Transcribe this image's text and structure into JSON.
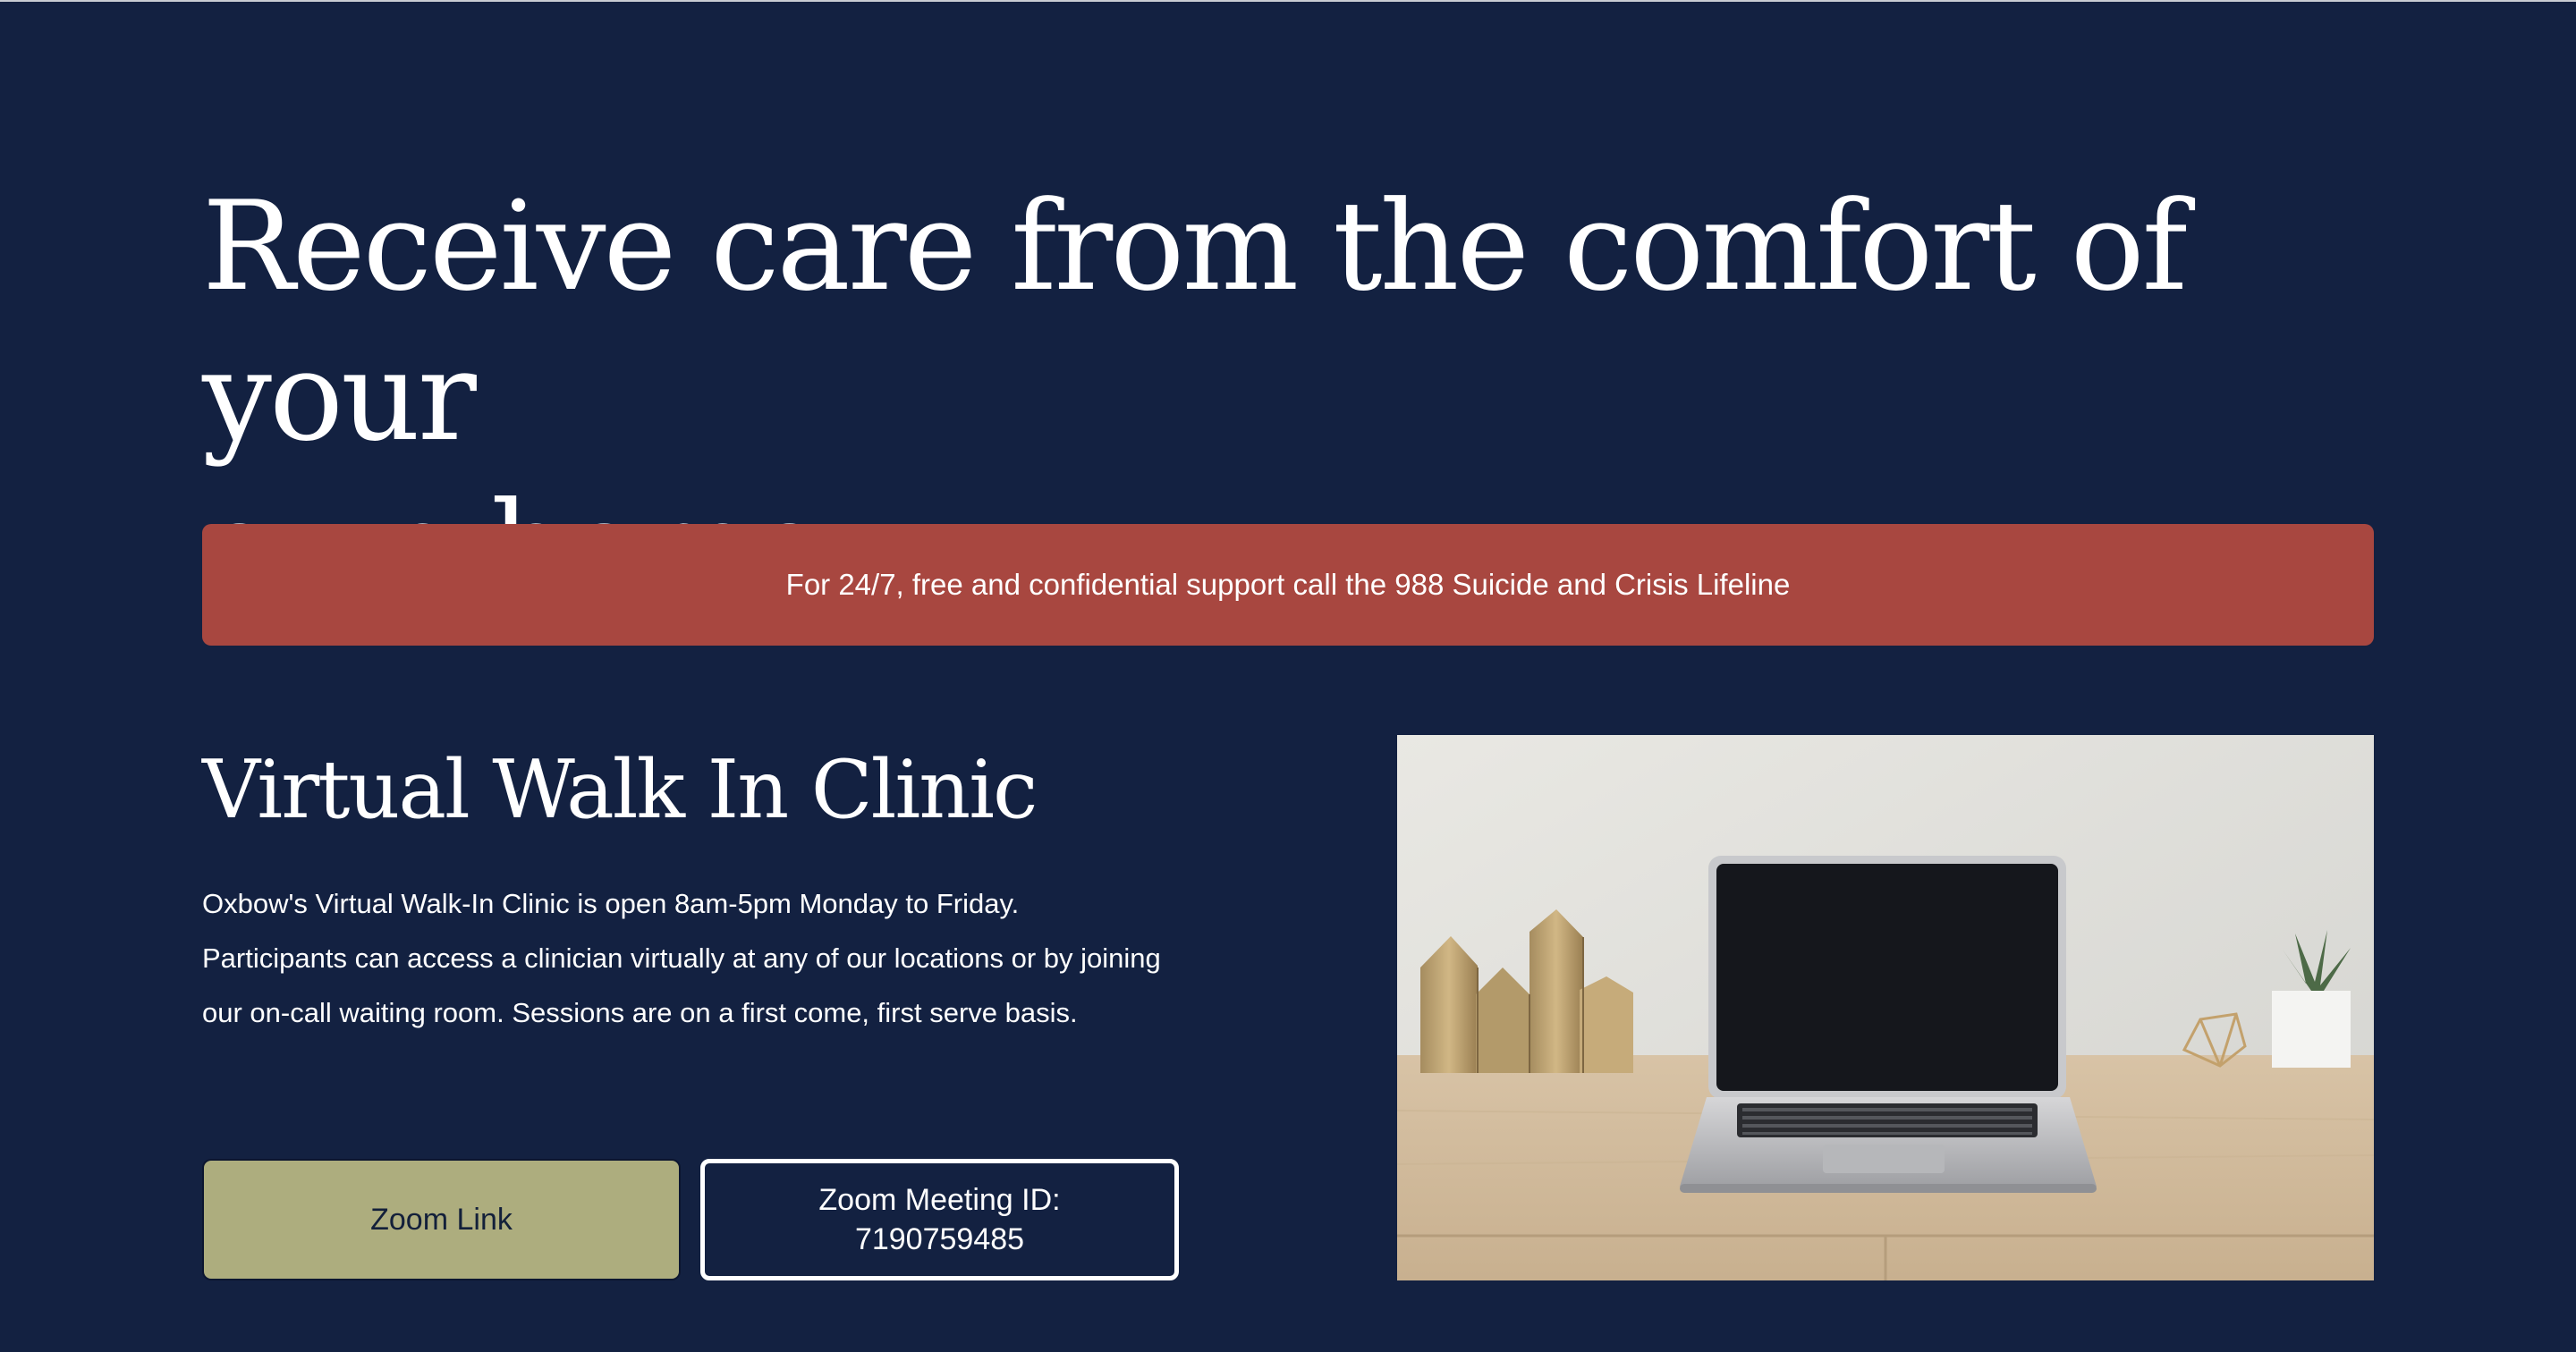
{
  "hero": {
    "headline_line1": "Receive care from the comfort of your",
    "headline_line2": "own home."
  },
  "crisis_banner": {
    "text": "For 24/7, free and confidential support call the 988 Suicide and Crisis Lifeline"
  },
  "clinic": {
    "title": "Virtual Walk In Clinic",
    "description": "Oxbow's Virtual Walk-In Clinic is open 8am-5pm Monday to Friday. Participants can access a clinician virtually at any of our locations or by joining our on-call waiting room. Sessions are on a first come, first serve basis.",
    "zoom_link_label": "Zoom Link",
    "meeting_id_label": "Zoom Meeting ID:",
    "meeting_id_value": "7190759485"
  },
  "photo": {
    "alt": "laptop-on-desk-photo"
  },
  "colors": {
    "background": "#132141",
    "crisis_banner": "#a84740",
    "zoom_button": "#adad7e",
    "text": "#ffffff"
  }
}
